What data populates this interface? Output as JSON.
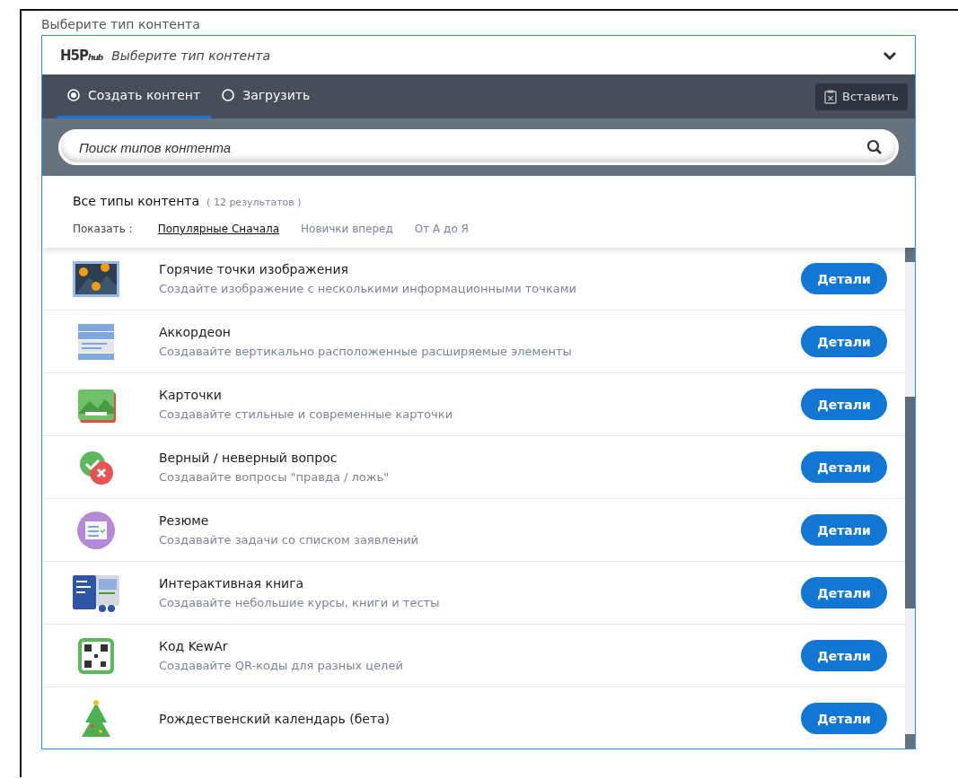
{
  "field_label": "Выберите тип контента",
  "hub": {
    "logo": "H5P",
    "logo_suffix": "hub",
    "title": "Выберите тип контента",
    "expanded": true
  },
  "tabs": [
    {
      "label": "Создать контент",
      "selected": true
    },
    {
      "label": "Загрузить",
      "selected": false
    }
  ],
  "paste_button": "Вставить",
  "search": {
    "placeholder": "Поиск типов контента"
  },
  "results": {
    "heading": "Все типы контента",
    "count": "( 12 результатов )",
    "sort_label": "Показать :",
    "sort_options": [
      {
        "label": "Популярные Сначала",
        "selected": true
      },
      {
        "label": "Новички вперед",
        "selected": false
      },
      {
        "label": "От А до Я",
        "selected": false
      }
    ]
  },
  "items": [
    {
      "title": "Горячие точки изображения",
      "description": "Создайте изображение с несколькими информационными точками",
      "button": "Детали"
    },
    {
      "title": "Аккордеон",
      "description": "Создавайте вертикально расположенные расширяемые элементы",
      "button": "Детали"
    },
    {
      "title": "Карточки",
      "description": "Создавайте стильные и современные карточки",
      "button": "Детали"
    },
    {
      "title": "Верный / неверный вопрос",
      "description": "Создавайте вопросы \"правда / ложь\"",
      "button": "Детали"
    },
    {
      "title": "Резюме",
      "description": "Создавайте задачи со списком заявлений",
      "button": "Детали"
    },
    {
      "title": "Интерактивная книга",
      "description": "Создавайте небольшие курсы, книги и тесты",
      "button": "Детали"
    },
    {
      "title": "Код KewAr",
      "description": "Создавайте QR-коды для разных целей",
      "button": "Детали"
    },
    {
      "title": "Рождественский календарь (бета)",
      "button": "Детали"
    }
  ]
}
